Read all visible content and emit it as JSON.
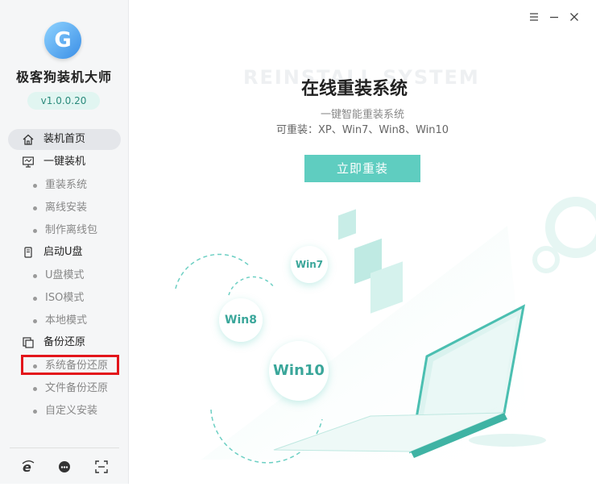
{
  "app": {
    "title": "极客狗装机大师",
    "version": "v1.0.0.20"
  },
  "nav": {
    "home": "装机首页",
    "one_click": "一键装机",
    "one_click_sub": [
      "重装系统",
      "离线安装",
      "制作离线包"
    ],
    "usb": "启动U盘",
    "usb_sub": [
      "U盘模式",
      "ISO模式",
      "本地模式"
    ],
    "backup": "备份还原",
    "backup_sub": [
      "系统备份还原",
      "文件备份还原",
      "自定义安装"
    ]
  },
  "main": {
    "bg_text": "REINSTALL SYSTEM",
    "title": "在线重装系统",
    "subtitle": "一键智能重装系统",
    "systems_line": "可重装：XP、Win7、Win8、Win10",
    "install_button": "立即重装"
  },
  "bubbles": {
    "win7": "Win7",
    "win8": "Win8",
    "win10": "Win10"
  },
  "colors": {
    "accent": "#5fcdc0",
    "highlight": "#e3151b"
  },
  "icons": {
    "home": "home-icon",
    "one_click": "monitor-icon",
    "usb": "usb-icon",
    "backup": "backup-icon",
    "ie": "ie-icon",
    "support": "headset-icon",
    "scan": "scan-icon"
  }
}
